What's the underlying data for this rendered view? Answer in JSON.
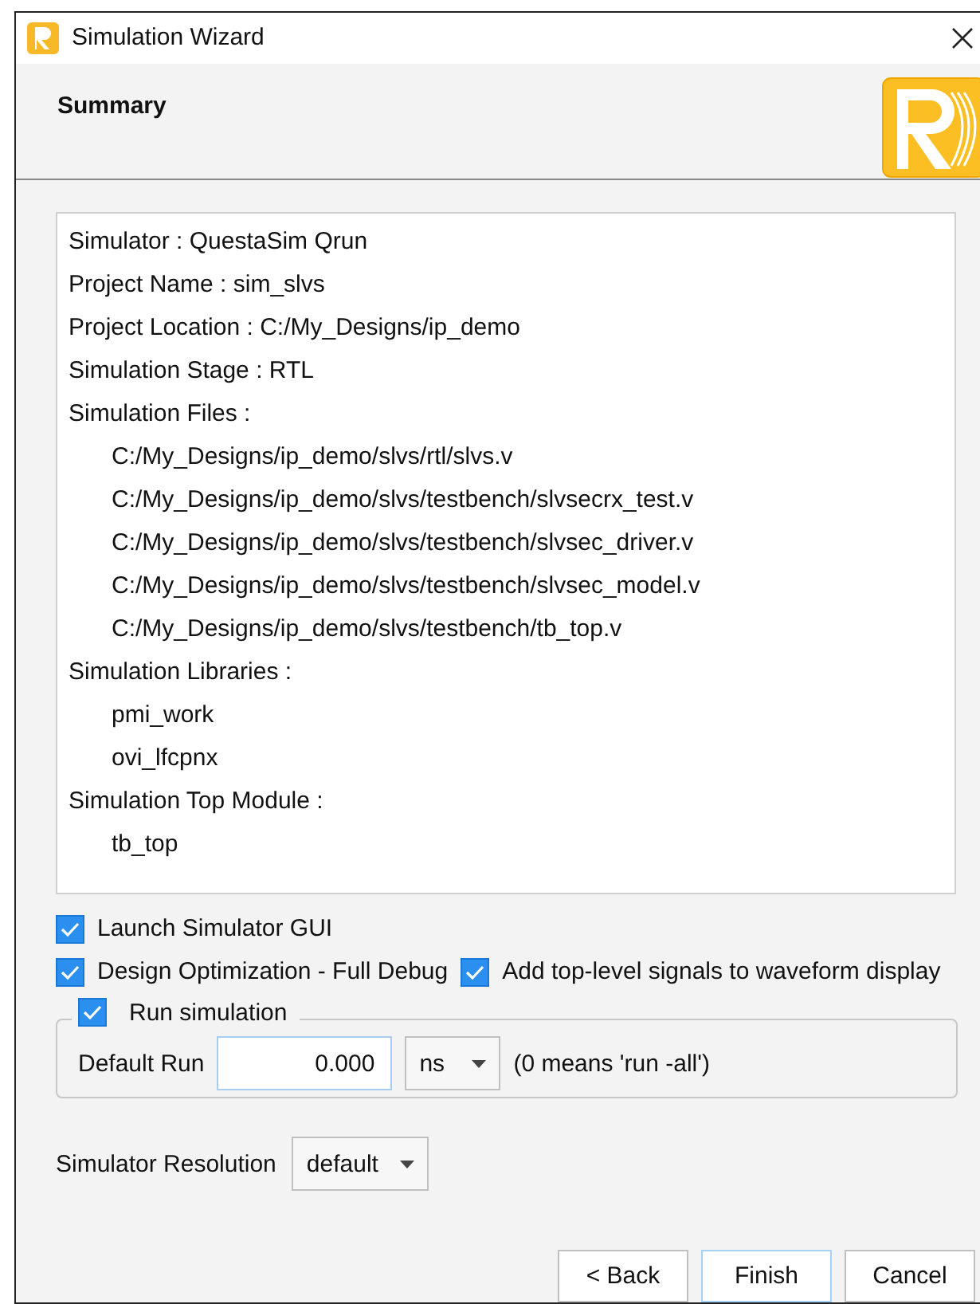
{
  "window": {
    "title": "Simulation Wizard"
  },
  "header": {
    "title": "Summary"
  },
  "summary": [
    {
      "label": "Simulator : QuestaSim Qrun"
    },
    {
      "label": "Project Name : sim_slvs"
    },
    {
      "label": "Project Location : C:/My_Designs/ip_demo"
    },
    {
      "label": "Simulation Stage : RTL"
    },
    {
      "label": "Simulation Files :",
      "children": [
        {
          "label": "C:/My_Designs/ip_demo/slvs/rtl/slvs.v"
        },
        {
          "label": "C:/My_Designs/ip_demo/slvs/testbench/slvsecrx_test.v"
        },
        {
          "label": "C:/My_Designs/ip_demo/slvs/testbench/slvsec_driver.v"
        },
        {
          "label": "C:/My_Designs/ip_demo/slvs/testbench/slvsec_model.v"
        },
        {
          "label": "C:/My_Designs/ip_demo/slvs/testbench/tb_top.v"
        }
      ]
    },
    {
      "label": "Simulation Libraries :",
      "children": [
        {
          "label": "pmi_work"
        },
        {
          "label": "ovi_lfcpnx"
        }
      ]
    },
    {
      "label": "Simulation Top Module :",
      "children": [
        {
          "label": "tb_top"
        }
      ]
    }
  ],
  "options": [
    [
      {
        "label": "Launch Simulator GUI",
        "checked": true
      }
    ],
    [
      {
        "label": "Design Optimization - Full Debug",
        "checked": true
      },
      {
        "label": "Add top-level signals to waveform display",
        "checked": true
      }
    ]
  ],
  "run_group": {
    "label": "Run simulation",
    "checked": true,
    "default_run_label": "Default Run",
    "default_run_value": "0.000",
    "unit": "ns",
    "hint": "(0 means 'run -all')"
  },
  "resolution": {
    "label": "Simulator Resolution",
    "value": "default"
  },
  "buttons": [
    {
      "label": "< Back",
      "focused": false
    },
    {
      "label": "Finish",
      "focused": true
    },
    {
      "label": "Cancel",
      "focused": false
    }
  ]
}
